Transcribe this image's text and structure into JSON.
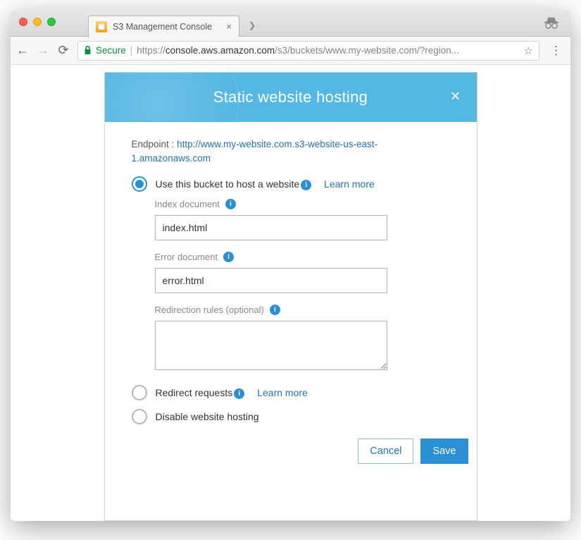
{
  "browser": {
    "tab_title": "S3 Management Console",
    "secure_label": "Secure",
    "url_prefix": "https://",
    "url_host": "console.aws.amazon.com",
    "url_path": "/s3/buckets/www.my-website.com/?region..."
  },
  "panel": {
    "title": "Static website hosting",
    "endpoint_label": "Endpoint :",
    "endpoint_url": "http://www.my-website.com.s3-website-us-east-1.amazonaws.com"
  },
  "options": {
    "host": {
      "label": "Use this bucket to host a website",
      "learn_more": "Learn more"
    },
    "redirect": {
      "label": "Redirect requests",
      "learn_more": "Learn more"
    },
    "disable": {
      "label": "Disable website hosting"
    }
  },
  "fields": {
    "index_label": "Index document",
    "index_value": "index.html",
    "error_label": "Error document",
    "error_value": "error.html",
    "redirection_label": "Redirection rules (optional)",
    "redirection_value": ""
  },
  "footer": {
    "cancel": "Cancel",
    "save": "Save"
  }
}
